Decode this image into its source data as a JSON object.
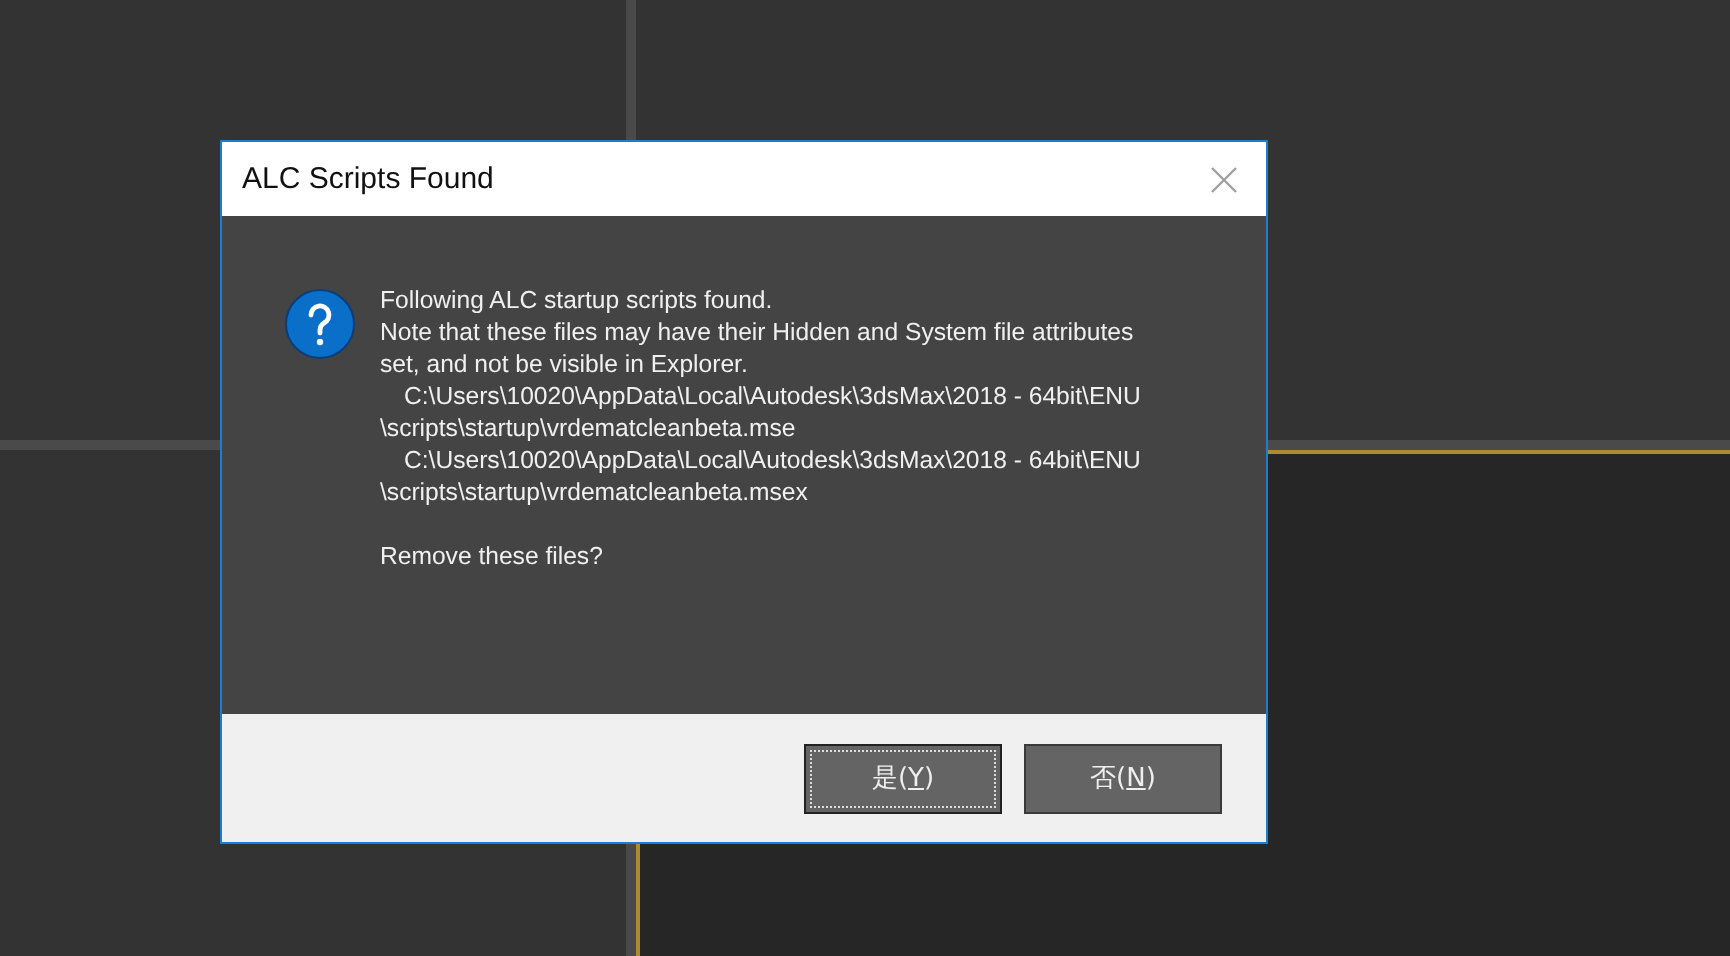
{
  "viewports": [
    {
      "active": false
    },
    {
      "active": false
    },
    {
      "active": false
    },
    {
      "active": true
    }
  ],
  "dialog": {
    "title": "ALC Scripts Found",
    "message_lines": [
      {
        "text": "Following ALC startup scripts found.",
        "indent": false
      },
      {
        "text": "Note that these files may have their Hidden and System file attributes",
        "indent": false
      },
      {
        "text": "set, and not be visible in Explorer.",
        "indent": false
      },
      {
        "text": "C:\\Users\\10020\\AppData\\Local\\Autodesk\\3dsMax\\2018 - 64bit\\ENU",
        "indent": true
      },
      {
        "text": "\\scripts\\startup\\vrdematcleanbeta.mse",
        "indent": false
      },
      {
        "text": "C:\\Users\\10020\\AppData\\Local\\Autodesk\\3dsMax\\2018 - 64bit\\ENU",
        "indent": true
      },
      {
        "text": "\\scripts\\startup\\vrdematcleanbeta.msex",
        "indent": false
      }
    ],
    "question": "Remove these files?",
    "buttons": [
      {
        "label_parts": [
          "是(",
          "Y",
          ")"
        ],
        "focused": true
      },
      {
        "label_parts": [
          "否(",
          "N",
          ")"
        ],
        "focused": false
      }
    ]
  }
}
